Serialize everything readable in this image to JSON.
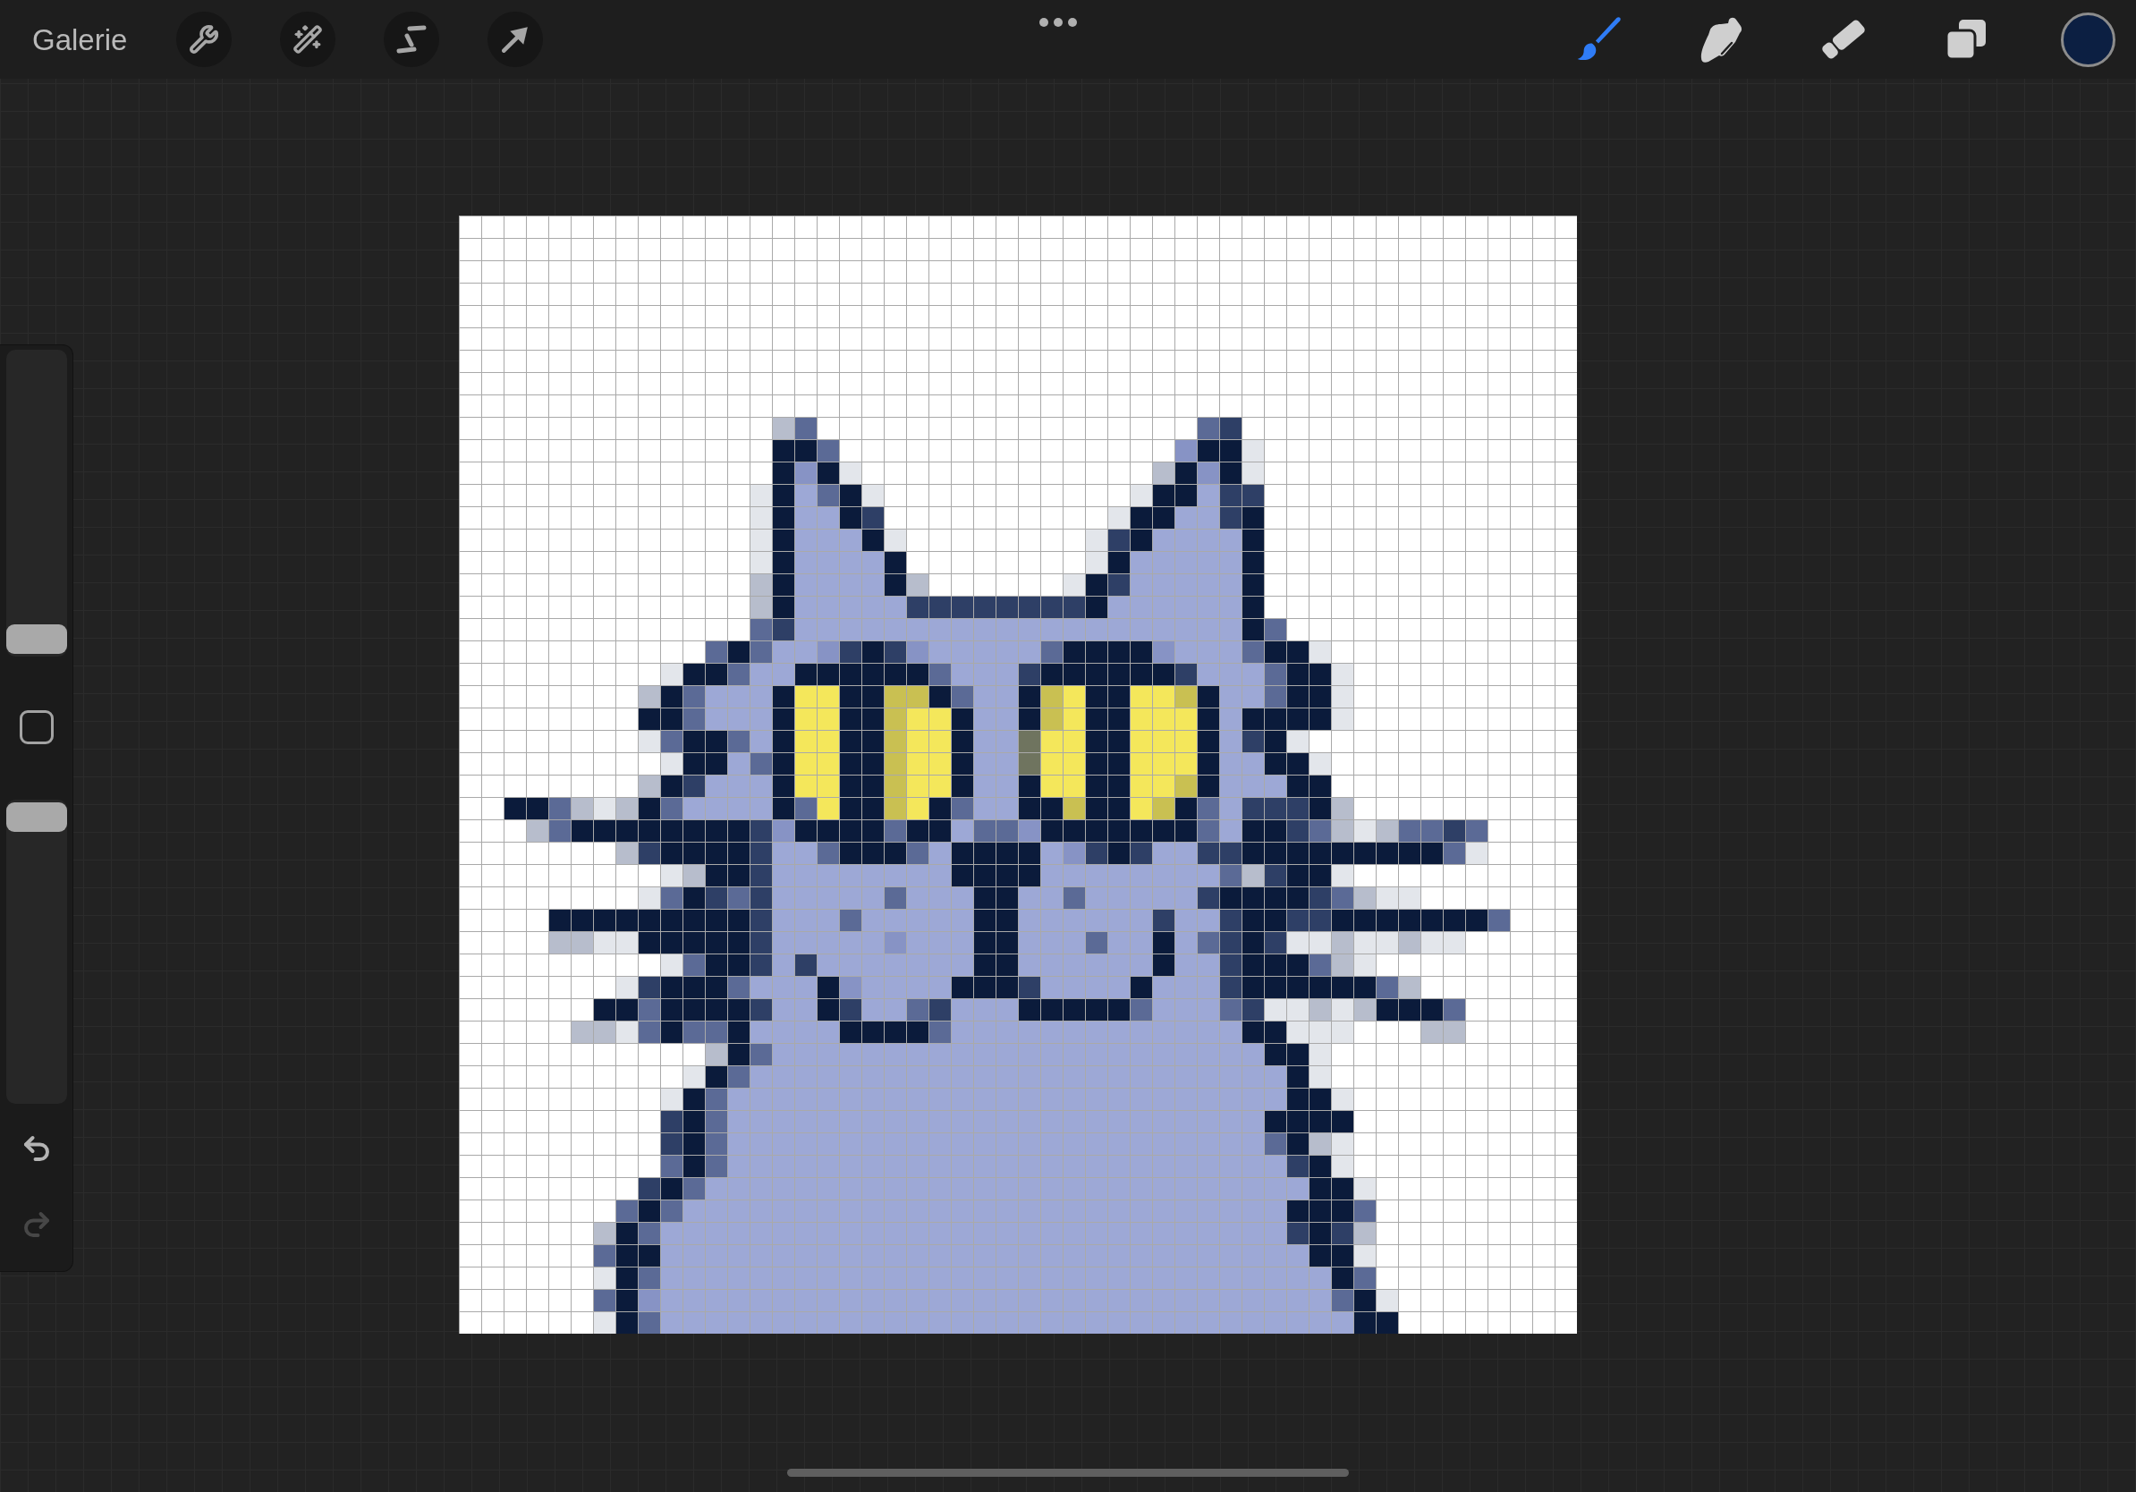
{
  "top_bar": {
    "gallery_label": "Galerie",
    "paint_tools": [
      {
        "kind": "brush",
        "selected": true
      },
      {
        "kind": "smudge",
        "selected": false
      },
      {
        "kind": "eraser",
        "selected": false
      }
    ],
    "color_swatch": {
      "color": "#0c1f42"
    }
  },
  "sidebar": {
    "sliders": [
      {
        "level": 0
      },
      {
        "level": 1
      }
    ],
    "undo": {
      "disabled": false
    },
    "redo": {
      "disabled": true
    }
  }
}
